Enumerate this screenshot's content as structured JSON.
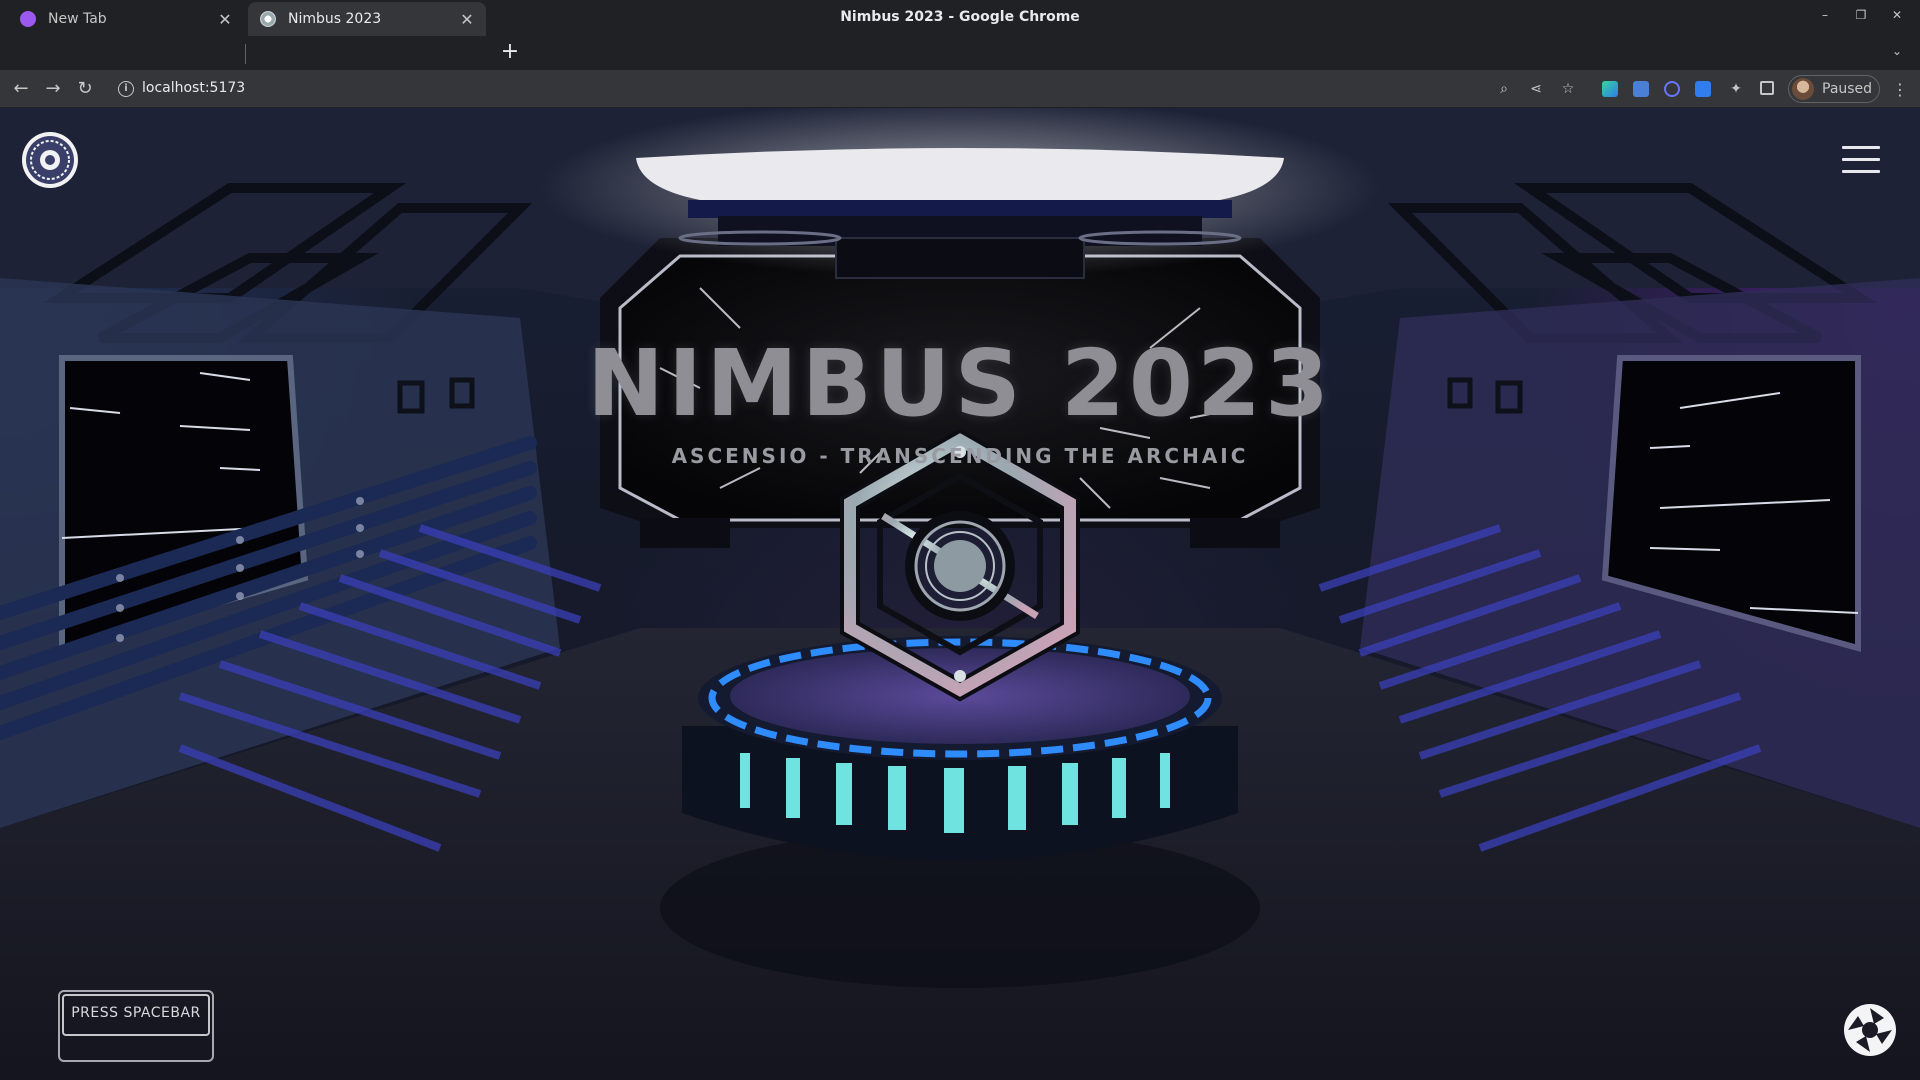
{
  "window": {
    "title": "Nimbus 2023 - Google Chrome",
    "controls": {
      "minimize": "–",
      "restore": "❐",
      "close": "✕"
    }
  },
  "tabs": [
    {
      "label": "New Tab",
      "active": false,
      "favicon_color": "#b56cff"
    },
    {
      "label": "Nimbus 2023",
      "active": true,
      "favicon_color": "#e0e0e6"
    }
  ],
  "toolbar": {
    "url": "localhost:5173",
    "profile_label": "Paused",
    "icons": [
      "back-icon",
      "forward-icon",
      "reload-icon",
      "zoom-icon",
      "share-icon",
      "bookmark-star-icon",
      "extensions-icon",
      "side-panel-icon",
      "menu-icon"
    ]
  },
  "page": {
    "title": "NIMBUS 2023",
    "subtitle": "ASCENSIO - TRANSCENDING THE ARCHAIC",
    "prompt_label": "PRESS SPACEBAR",
    "accent_colors": {
      "platform_glow": "#2f8cff",
      "pillar_glow": "#6fe3e0",
      "purple_haze": "#5a1e8c"
    }
  }
}
